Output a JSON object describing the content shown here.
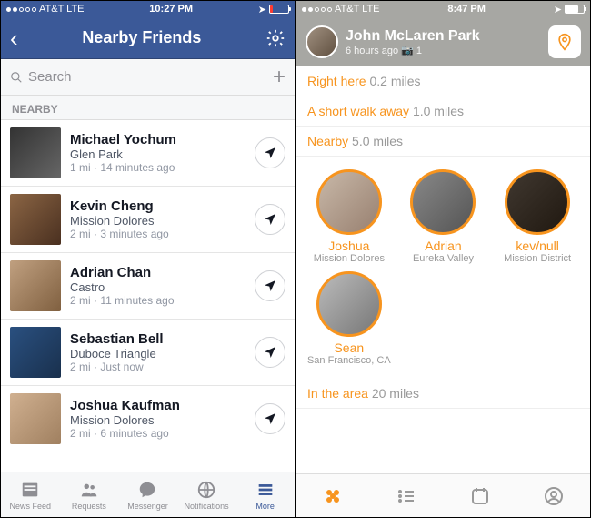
{
  "fb": {
    "status": {
      "carrier": "AT&T  LTE",
      "time": "10:27 PM"
    },
    "title": "Nearby Friends",
    "search_placeholder": "Search",
    "section": "NEARBY",
    "friends": [
      {
        "name": "Michael Yochum",
        "loc": "Glen Park",
        "meta": "1 mi · 14 minutes ago"
      },
      {
        "name": "Kevin Cheng",
        "loc": "Mission Dolores",
        "meta": "2 mi · 3 minutes ago"
      },
      {
        "name": "Adrian Chan",
        "loc": "Castro",
        "meta": "2 mi · 11 minutes ago"
      },
      {
        "name": "Sebastian Bell",
        "loc": "Duboce Triangle",
        "meta": "2 mi · Just now"
      },
      {
        "name": "Joshua Kaufman",
        "loc": "Mission Dolores",
        "meta": "2 mi · 6 minutes ago"
      }
    ],
    "tabs": [
      {
        "label": "News Feed"
      },
      {
        "label": "Requests"
      },
      {
        "label": "Messenger"
      },
      {
        "label": "Notifications"
      },
      {
        "label": "More"
      }
    ]
  },
  "sw": {
    "status": {
      "carrier": "AT&T  LTE",
      "time": "8:47 PM"
    },
    "header": {
      "name": "John McLaren Park",
      "meta": "6 hours ago 📷 1"
    },
    "distances": [
      {
        "label": "Right here",
        "mi": "0.2 miles"
      },
      {
        "label": "A short walk away",
        "mi": "1.0 miles"
      },
      {
        "label": "Nearby",
        "mi": "5.0 miles"
      }
    ],
    "people": [
      {
        "name": "Joshua",
        "loc": "Mission Dolores"
      },
      {
        "name": "Adrian",
        "loc": "Eureka Valley"
      },
      {
        "name": "kev/null",
        "loc": "Mission District"
      },
      {
        "name": "Sean",
        "loc": "San Francisco, CA"
      }
    ],
    "distance_footer": {
      "label": "In the area",
      "mi": "20 miles"
    }
  }
}
